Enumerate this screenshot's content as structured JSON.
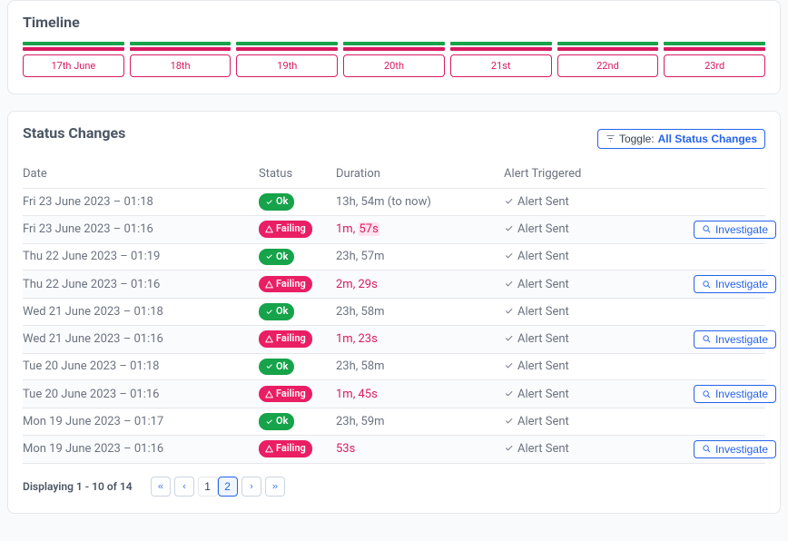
{
  "timeline": {
    "title": "Timeline",
    "days": [
      "17th June",
      "18th",
      "19th",
      "20th",
      "21st",
      "22nd",
      "23rd"
    ]
  },
  "status_changes": {
    "title": "Status Changes",
    "toggle_prefix": "Toggle:",
    "toggle_mode": "All Status Changes",
    "headers": {
      "date": "Date",
      "status": "Status",
      "duration": "Duration",
      "alert": "Alert Triggered"
    },
    "labels": {
      "ok": "Ok",
      "failing": "Failing",
      "alert_sent": "Alert Sent",
      "investigate": "Investigate"
    },
    "rows": [
      {
        "date": "Fri 23 June 2023 – 01:18",
        "status": "ok",
        "duration": "13h, 54m (to now)",
        "fail": false,
        "investigate": false
      },
      {
        "date": "Fri 23 June 2023 – 01:16",
        "status": "fail",
        "duration": "1m, ",
        "duration_hl": "57s",
        "fail": true,
        "investigate": true
      },
      {
        "date": "Thu 22 June 2023 – 01:19",
        "status": "ok",
        "duration": "23h, 57m",
        "fail": false,
        "investigate": false
      },
      {
        "date": "Thu 22 June 2023 – 01:16",
        "status": "fail",
        "duration": "2m, 29s",
        "fail": true,
        "investigate": true
      },
      {
        "date": "Wed 21 June 2023 – 01:18",
        "status": "ok",
        "duration": "23h, 58m",
        "fail": false,
        "investigate": false
      },
      {
        "date": "Wed 21 June 2023 – 01:16",
        "status": "fail",
        "duration": "1m, 23s",
        "fail": true,
        "investigate": true
      },
      {
        "date": "Tue 20 June 2023 – 01:18",
        "status": "ok",
        "duration": "23h, 58m",
        "fail": false,
        "investigate": false
      },
      {
        "date": "Tue 20 June 2023 – 01:16",
        "status": "fail",
        "duration": "1m, 45s",
        "fail": true,
        "investigate": true
      },
      {
        "date": "Mon 19 June 2023 – 01:17",
        "status": "ok",
        "duration": "23h, 59m",
        "fail": false,
        "investigate": false
      },
      {
        "date": "Mon 19 June 2023 – 01:16",
        "status": "fail",
        "duration": "53s",
        "fail": true,
        "investigate": true
      }
    ],
    "pagination": {
      "summary": "Displaying 1 - 10 of 14",
      "pages": [
        "1",
        "2"
      ],
      "current": "1"
    }
  }
}
